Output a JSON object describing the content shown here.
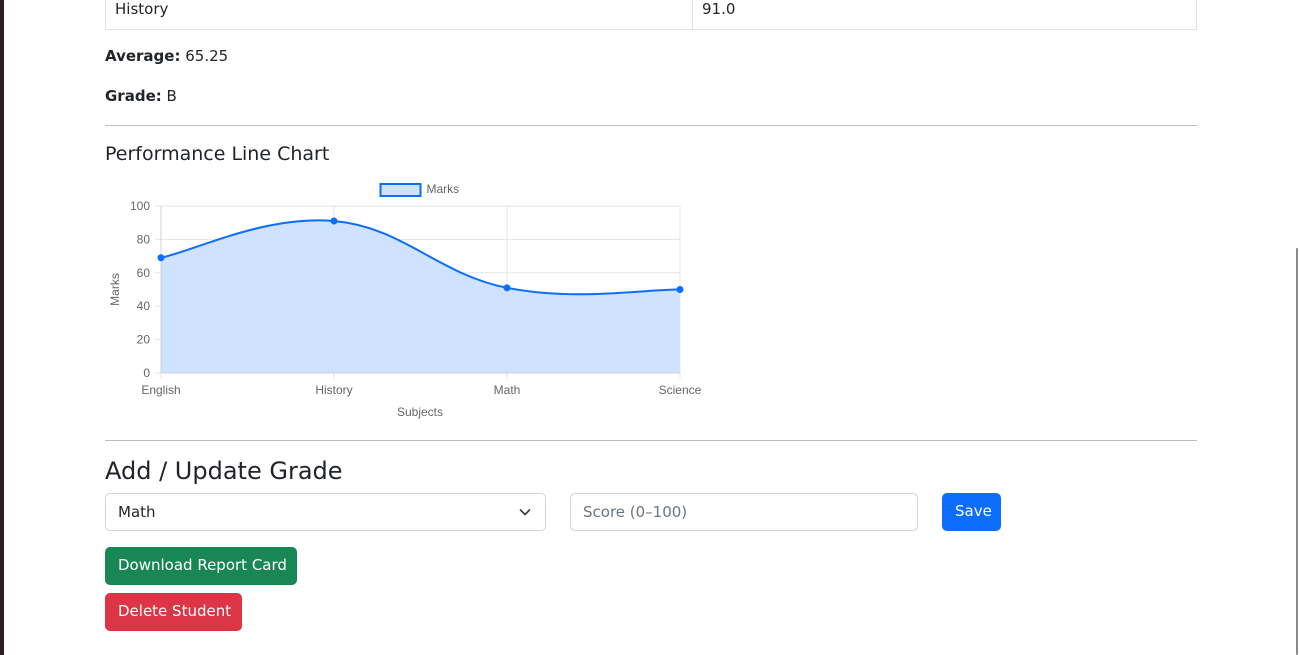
{
  "table": {
    "last_row": {
      "subject": "History",
      "score": "91.0"
    }
  },
  "summary": {
    "average_label": "Average:",
    "average_value": "65.25",
    "grade_label": "Grade:",
    "grade_value": "B"
  },
  "chart_section": {
    "title": "Performance Line Chart"
  },
  "chart_data": {
    "type": "area",
    "categories": [
      "English",
      "History",
      "Math",
      "Science"
    ],
    "series": [
      {
        "name": "Marks",
        "values": [
          69,
          91,
          51,
          50
        ],
        "color": "#0d6efd",
        "fill": "#cfe2ff"
      }
    ],
    "xlabel": "Subjects",
    "ylabel": "Marks",
    "ylim": [
      0,
      100
    ],
    "yticks": [
      0,
      20,
      40,
      60,
      80,
      100
    ],
    "grid": true,
    "legend": "top"
  },
  "form": {
    "title": "Add / Update Grade",
    "subject_selected": "Math",
    "score_placeholder": "Score (0–100)",
    "save_label": "Save"
  },
  "actions": {
    "download_label": "Download Report Card",
    "delete_label": "Delete Student"
  },
  "colors": {
    "primary": "#0d6efd",
    "success": "#198754",
    "danger": "#dc3545"
  }
}
